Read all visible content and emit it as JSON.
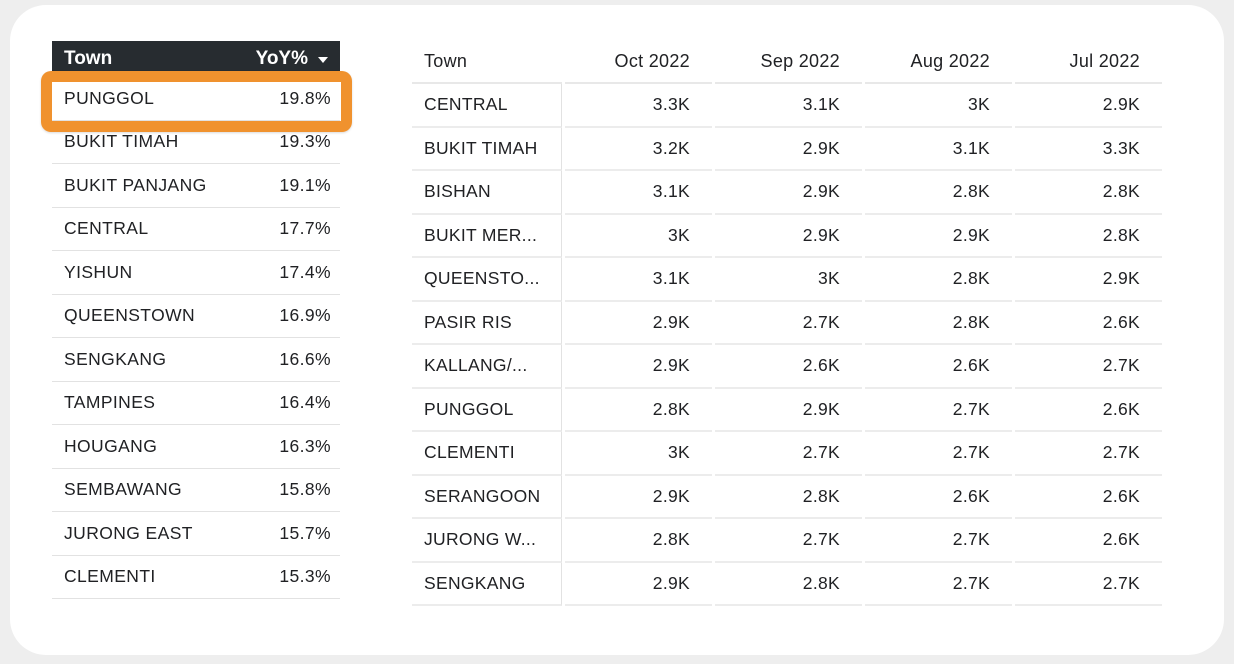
{
  "colors": {
    "header_bg": "#272c30",
    "highlight": "#f0922e",
    "page_bg": "#eeeeee"
  },
  "left_table": {
    "headers": {
      "town": "Town",
      "yoy": "YoY%"
    },
    "sort_icon": "caret-down-icon",
    "highlighted_row": 0,
    "rows": [
      {
        "town": "PUNGGOL",
        "yoy": "19.8%"
      },
      {
        "town": "BUKIT TIMAH",
        "yoy": "19.3%"
      },
      {
        "town": "BUKIT PANJANG",
        "yoy": "19.1%"
      },
      {
        "town": "CENTRAL",
        "yoy": "17.7%"
      },
      {
        "town": "YISHUN",
        "yoy": "17.4%"
      },
      {
        "town": "QUEENSTOWN",
        "yoy": "16.9%"
      },
      {
        "town": "SENGKANG",
        "yoy": "16.6%"
      },
      {
        "town": "TAMPINES",
        "yoy": "16.4%"
      },
      {
        "town": "HOUGANG",
        "yoy": "16.3%"
      },
      {
        "town": "SEMBAWANG",
        "yoy": "15.8%"
      },
      {
        "town": "JURONG EAST",
        "yoy": "15.7%"
      },
      {
        "town": "CLEMENTI",
        "yoy": "15.3%"
      }
    ]
  },
  "right_table": {
    "headers": [
      "Town",
      "Oct 2022",
      "Sep 2022",
      "Aug 2022",
      "Jul 2022"
    ],
    "rows": [
      {
        "town": "CENTRAL",
        "values": [
          "3.3K",
          "3.1K",
          "3K",
          "2.9K"
        ]
      },
      {
        "town": "BUKIT TIMAH",
        "values": [
          "3.2K",
          "2.9K",
          "3.1K",
          "3.3K"
        ]
      },
      {
        "town": "BISHAN",
        "values": [
          "3.1K",
          "2.9K",
          "2.8K",
          "2.8K"
        ]
      },
      {
        "town": "BUKIT MER...",
        "values": [
          "3K",
          "2.9K",
          "2.9K",
          "2.8K"
        ]
      },
      {
        "town": "QUEENSTO...",
        "values": [
          "3.1K",
          "3K",
          "2.8K",
          "2.9K"
        ]
      },
      {
        "town": "PASIR RIS",
        "values": [
          "2.9K",
          "2.7K",
          "2.8K",
          "2.6K"
        ]
      },
      {
        "town": "KALLANG/...",
        "values": [
          "2.9K",
          "2.6K",
          "2.6K",
          "2.7K"
        ]
      },
      {
        "town": "PUNGGOL",
        "values": [
          "2.8K",
          "2.9K",
          "2.7K",
          "2.6K"
        ]
      },
      {
        "town": "CLEMENTI",
        "values": [
          "3K",
          "2.7K",
          "2.7K",
          "2.7K"
        ]
      },
      {
        "town": "SERANGOON",
        "values": [
          "2.9K",
          "2.8K",
          "2.6K",
          "2.6K"
        ]
      },
      {
        "town": "JURONG W...",
        "values": [
          "2.8K",
          "2.7K",
          "2.7K",
          "2.6K"
        ]
      },
      {
        "town": "SENGKANG",
        "values": [
          "2.9K",
          "2.8K",
          "2.7K",
          "2.7K"
        ]
      }
    ]
  }
}
